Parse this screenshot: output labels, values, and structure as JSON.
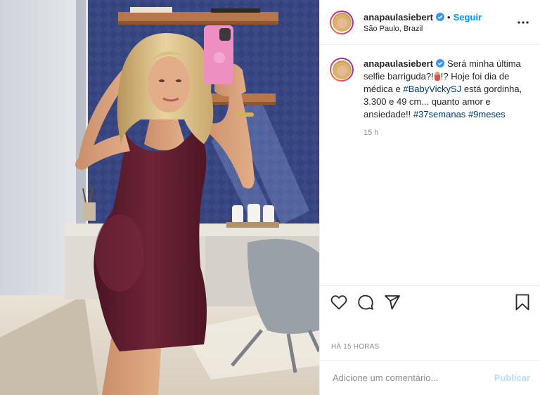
{
  "post": {
    "username": "anapaulasiebert",
    "follow_label": "Seguir",
    "location": "São Paulo, Brazil",
    "caption": {
      "line1": "Será minha última",
      "line2_prefix": "selfie barriguda?!",
      "line2_suffix": "!? Hoje foi dia de",
      "line3_prefix": "médica e",
      "line3_tag": "#BabyVickySJ",
      "line3_suffix": "está gordinha,",
      "line4": "3.300 e 49 cm... quanto amor e",
      "line5_prefix": "ansiedade!!",
      "tag_weeks": "#37semanas",
      "tag_months": "#9meses"
    },
    "caption_time": "15 h",
    "posted_ago": "HÁ 15 HORAS",
    "comment_placeholder": "Adicione um comentário...",
    "publish_label": "Publicar"
  },
  "colors": {
    "link_blue": "#0095f6",
    "hashtag": "#00376b",
    "verified": "#3897f0",
    "publish_disabled": "#b2dffc"
  },
  "icons": [
    "verified-badge-icon",
    "more-options-icon",
    "heart-icon",
    "comment-icon",
    "share-icon",
    "bookmark-icon"
  ]
}
